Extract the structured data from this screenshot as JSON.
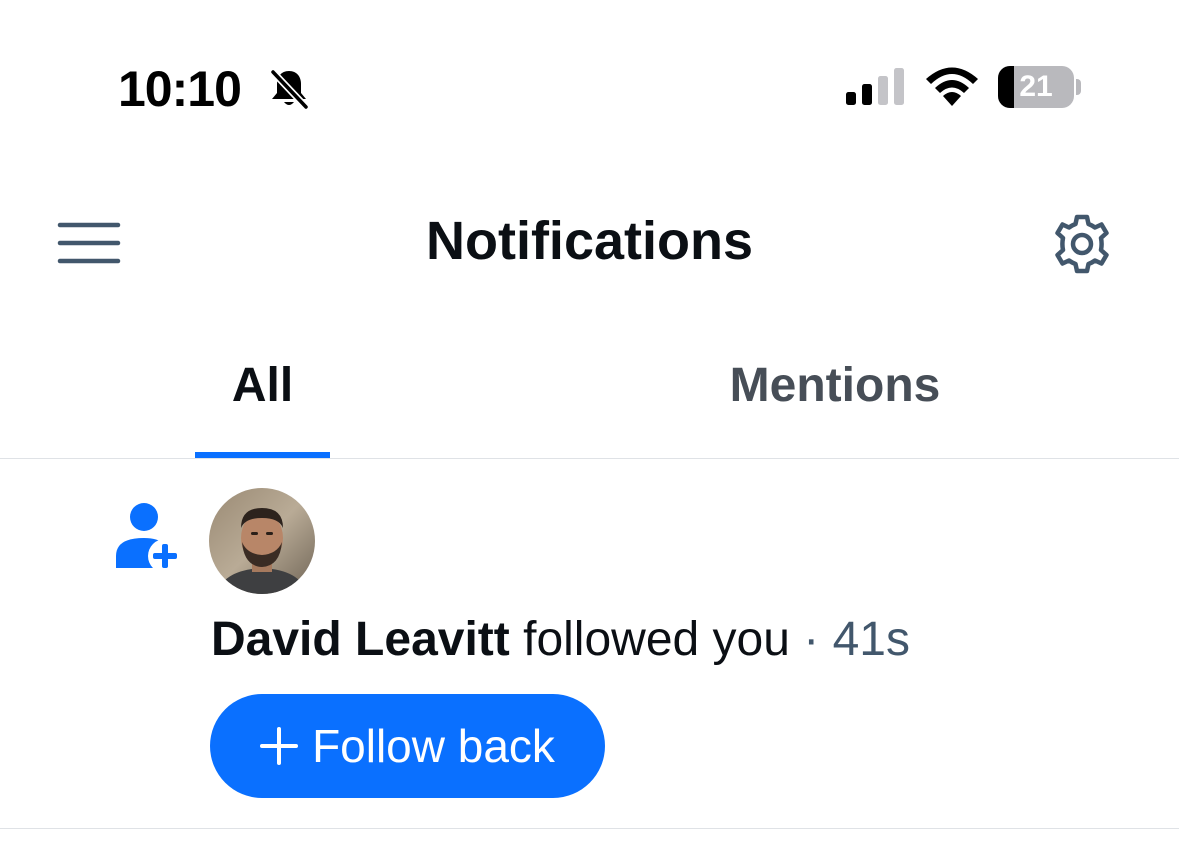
{
  "status_bar": {
    "time": "10:10",
    "battery_level": "21",
    "battery_fraction": 0.21,
    "icons": [
      "bell-off-icon",
      "signal-icon",
      "wifi-icon",
      "battery-icon"
    ]
  },
  "header": {
    "title": "Notifications",
    "left_icon": "menu-icon",
    "right_icon": "gear-icon"
  },
  "tabs": [
    {
      "label": "All",
      "selected": true
    },
    {
      "label": "Mentions",
      "selected": false
    }
  ],
  "notifications": [
    {
      "type_icon": "person-add-icon",
      "author": "David Leavitt",
      "action": " followed you",
      "separator": " · ",
      "time": "41s",
      "button_label": "Follow back",
      "button_icon": "plus-icon"
    }
  ],
  "colors": {
    "accent": "#0a70ff",
    "icon_gray": "#42576c",
    "tab_inactive": "#474e57",
    "divider": "#dfe2e6"
  }
}
